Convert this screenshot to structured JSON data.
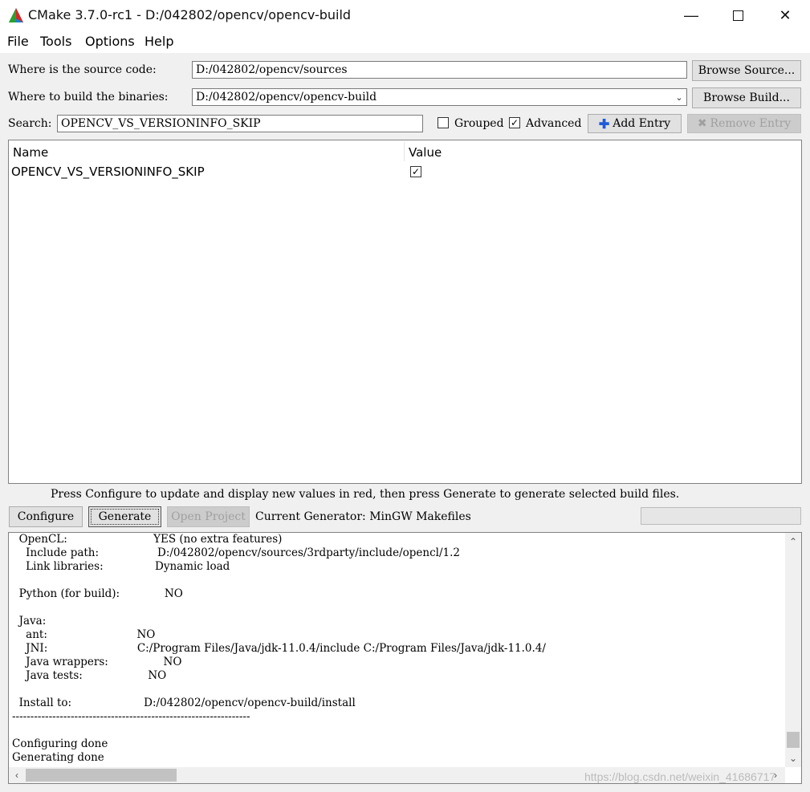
{
  "window": {
    "title": "CMake 3.7.0-rc1 - D:/042802/opencv/opencv-build"
  },
  "menu": [
    "File",
    "Tools",
    "Options",
    "Help"
  ],
  "source": {
    "label": "Where is the source code:",
    "value": "D:/042802/opencv/sources",
    "button": "Browse Source..."
  },
  "build": {
    "label": "Where to build the binaries:",
    "value": "D:/042802/opencv/opencv-build",
    "button": "Browse Build..."
  },
  "search": {
    "label": "Search:",
    "value": "OPENCV_VS_VERSIONINFO_SKIP"
  },
  "options": {
    "grouped_label": "Grouped",
    "grouped": false,
    "advanced_label": "Advanced",
    "advanced": true
  },
  "entry_buttons": {
    "add": "Add Entry",
    "remove": "Remove Entry"
  },
  "table": {
    "columns": [
      "Name",
      "Value"
    ],
    "rows": [
      {
        "name": "OPENCV_VS_VERSIONINFO_SKIP",
        "checked": true
      }
    ]
  },
  "hint": "Press Configure to update and display new values in red, then press Generate to generate selected build files.",
  "actions": {
    "configure": "Configure",
    "generate": "Generate",
    "open_project": "Open Project",
    "generator": "Current Generator: MinGW Makefiles"
  },
  "log_lines": [
    "  OpenCL:                         YES (no extra features)",
    "    Include path:                 D:/042802/opencv/sources/3rdparty/include/opencl/1.2",
    "    Link libraries:               Dynamic load",
    "",
    "  Python (for build):             NO",
    "",
    "  Java:",
    "    ant:                          NO",
    "    JNI:                          C:/Program Files/Java/jdk-11.0.4/include C:/Program Files/Java/jdk-11.0.4/",
    "    Java wrappers:                NO",
    "    Java tests:                   NO",
    "",
    "  Install to:                     D:/042802/opencv/opencv-build/install",
    "-----------------------------------------------------------------",
    "",
    "Configuring done",
    "Generating done"
  ],
  "watermark": "https://blog.csdn.net/weixin_41686717",
  "colors": {
    "accent": "#0078d7",
    "panel": "#f0f0f0"
  }
}
